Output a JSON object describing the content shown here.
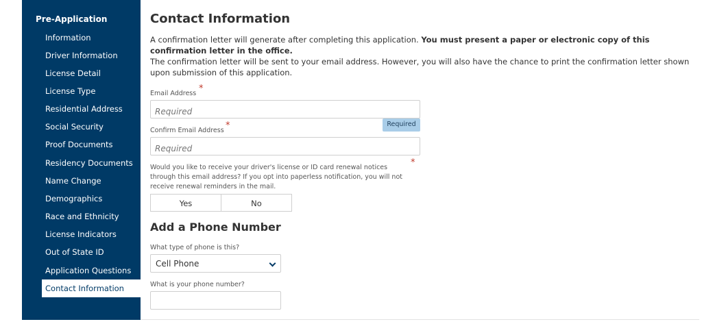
{
  "sidebar": {
    "header": "Pre-Application",
    "items": [
      {
        "label": "Information"
      },
      {
        "label": "Driver Information"
      },
      {
        "label": "License Detail"
      },
      {
        "label": "License Type"
      },
      {
        "label": "Residential Address"
      },
      {
        "label": "Social Security"
      },
      {
        "label": "Proof Documents"
      },
      {
        "label": "Residency Documents"
      },
      {
        "label": "Name Change"
      },
      {
        "label": "Demographics"
      },
      {
        "label": "Race and Ethnicity"
      },
      {
        "label": "License Indicators"
      },
      {
        "label": "Out of State ID"
      },
      {
        "label": "Application Questions"
      },
      {
        "label": "Contact Information"
      }
    ],
    "active_index": 14
  },
  "main": {
    "title": "Contact Information",
    "para1_text": "A confirmation letter will generate after completing this application. ",
    "para1_bold": "You must present a paper or electronic copy of this confirmation letter in the office.",
    "para2": "The confirmation letter will be sent to your email address. However, you will also have the chance to print the confirmation letter shown upon submission of this application.",
    "email": {
      "label": "Email Address",
      "placeholder": "Required",
      "value": ""
    },
    "required_tooltip": "Required",
    "confirm_email": {
      "label": "Confirm Email Address",
      "placeholder": "Required",
      "value": ""
    },
    "renewal_question": "Would you like to receive your driver's license or ID card renewal notices through this email address? If you opt into paperless notification, you will not receive renewal reminders in the mail.",
    "yes_label": "Yes",
    "no_label": "No",
    "required_marker": "*"
  },
  "phone": {
    "section_title": "Add a Phone Number",
    "type_label": "What type of phone is this?",
    "type_value": "Cell Phone",
    "number_label": "What is your phone number?",
    "number_value": ""
  },
  "colors": {
    "sidebar_bg": "#003a66",
    "tooltip_bg": "#a9cde8",
    "required_star": "#c0392b"
  }
}
